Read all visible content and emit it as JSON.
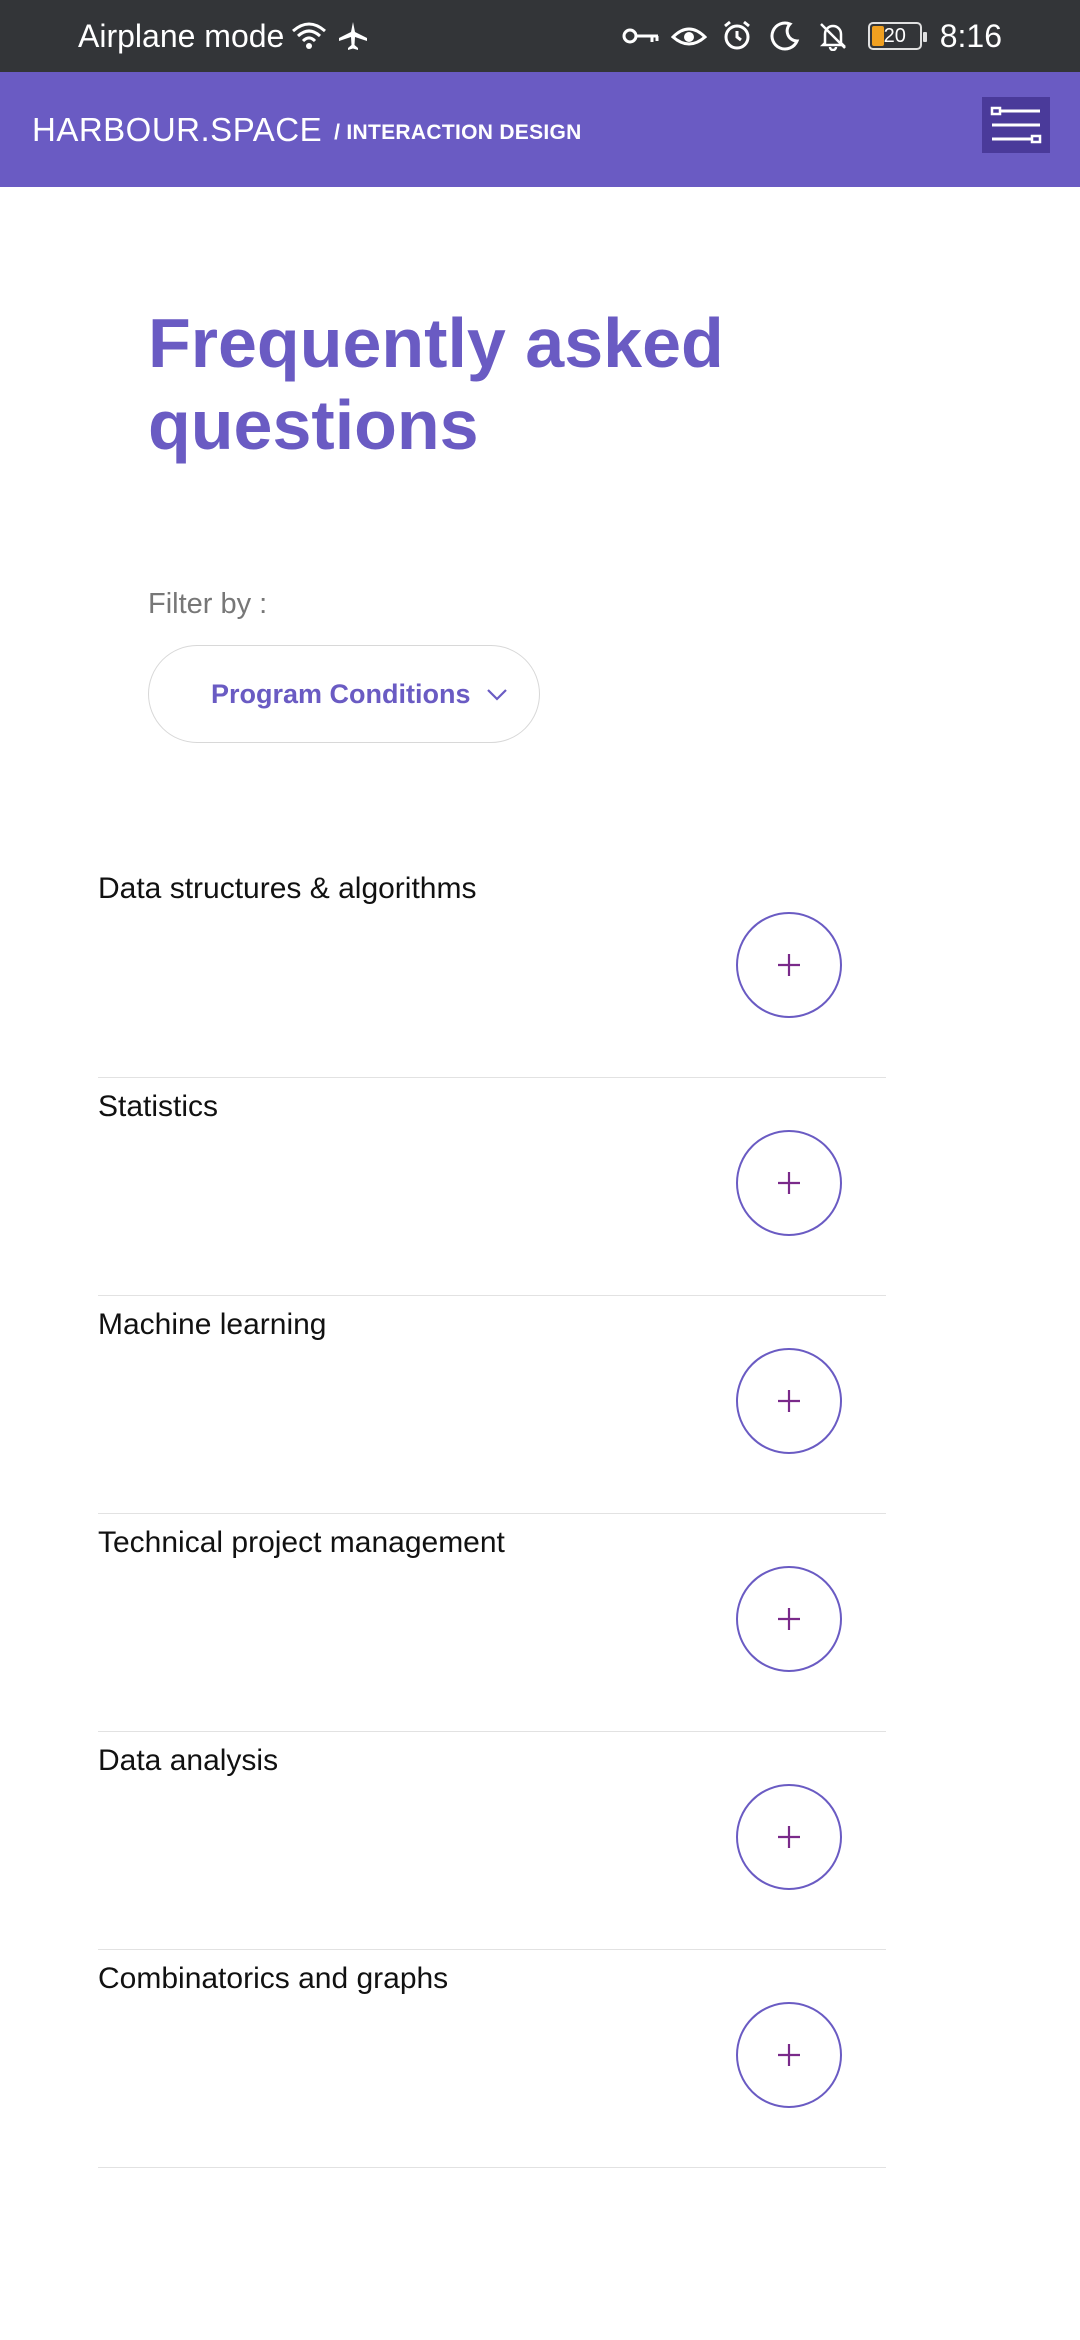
{
  "status_bar": {
    "mode_text": "Airplane mode",
    "time": "8:16",
    "battery_level": "20",
    "icons": [
      "wifi-icon",
      "airplane-icon",
      "vpn-key-icon",
      "eye-icon",
      "alarm-icon",
      "moon-icon",
      "bell-off-icon",
      "battery-icon"
    ]
  },
  "header": {
    "brand": "HARBOUR.SPACE",
    "section": "/ INTERACTION DESIGN",
    "menu_icon": "menu-icon",
    "color": "#6a5bc3"
  },
  "main": {
    "title": "Frequently asked questions",
    "filter": {
      "label": "Filter by :",
      "selected": "Program Conditions"
    }
  },
  "faq": {
    "items": [
      {
        "title": "Data structures & algorithms"
      },
      {
        "title": "Statistics"
      },
      {
        "title": "Machine learning"
      },
      {
        "title": "Technical project management"
      },
      {
        "title": "Data analysis"
      },
      {
        "title": "Combinatorics and graphs"
      }
    ],
    "toggle_icon": "plus-icon"
  },
  "colors": {
    "accent": "#6a5bc3",
    "plus": "#7a2a8a",
    "status_bar": "#333538"
  }
}
